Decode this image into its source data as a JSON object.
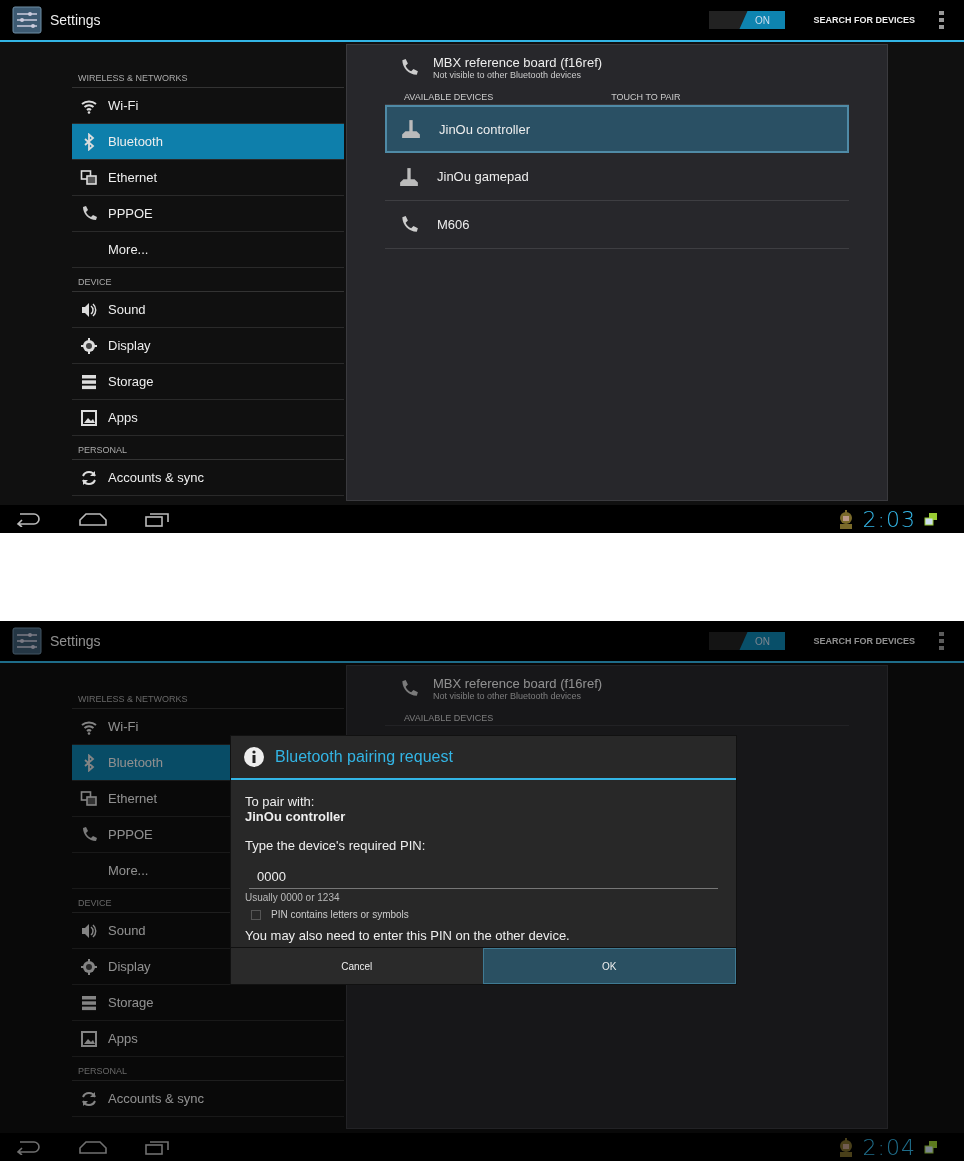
{
  "screens": [
    {
      "action_bar": {
        "title": "Settings",
        "toggle": {
          "label": "ON",
          "on": true
        },
        "action": "SEARCH FOR DEVICES"
      },
      "sidebar": {
        "sections": [
          {
            "header": "WIRELESS & NETWORKS",
            "items": [
              {
                "label": "Wi-Fi",
                "kind": "wifi",
                "selected": false
              },
              {
                "label": "Bluetooth",
                "kind": "bluetooth",
                "selected": true
              },
              {
                "label": "Ethernet",
                "kind": "ethernet",
                "selected": false
              },
              {
                "label": "PPPOE",
                "kind": "phone",
                "selected": false
              },
              {
                "label": "More...",
                "kind": "plain",
                "selected": false
              }
            ]
          },
          {
            "header": "DEVICE",
            "items": [
              {
                "label": "Sound",
                "kind": "sound",
                "selected": false
              },
              {
                "label": "Display",
                "kind": "display",
                "selected": false
              },
              {
                "label": "Storage",
                "kind": "storage",
                "selected": false
              },
              {
                "label": "Apps",
                "kind": "apps",
                "selected": false
              }
            ]
          },
          {
            "header": "PERSONAL",
            "items": [
              {
                "label": "Accounts & sync",
                "kind": "sync",
                "selected": false
              }
            ]
          }
        ]
      },
      "panel": {
        "own_device": {
          "name": "MBX reference board (f16ref)",
          "status": "Not visible to other Bluetooth devices"
        },
        "list_header": "AVAILABLE DEVICES",
        "list_hint": "TOUCH TO PAIR",
        "devices": [
          {
            "name": "JinOu controller",
            "kind": "joystick",
            "selected": true
          },
          {
            "name": "JinOu gamepad",
            "kind": "joystick",
            "selected": false
          },
          {
            "name": "M606",
            "kind": "phone",
            "selected": false
          }
        ]
      },
      "status_bar": {
        "time": "2:03"
      },
      "dimmed": false
    },
    {
      "action_bar": {
        "title": "Settings",
        "toggle": {
          "label": "ON",
          "on": true
        },
        "action": "SEARCH FOR DEVICES"
      },
      "sidebar": {
        "sections": [
          {
            "header": "WIRELESS & NETWORKS",
            "items": [
              {
                "label": "Wi-Fi",
                "kind": "wifi",
                "selected": false
              },
              {
                "label": "Bluetooth",
                "kind": "bluetooth",
                "selected": true
              },
              {
                "label": "Ethernet",
                "kind": "ethernet",
                "selected": false
              },
              {
                "label": "PPPOE",
                "kind": "phone",
                "selected": false
              },
              {
                "label": "More...",
                "kind": "plain",
                "selected": false
              }
            ]
          },
          {
            "header": "DEVICE",
            "items": [
              {
                "label": "Sound",
                "kind": "sound",
                "selected": false
              },
              {
                "label": "Display",
                "kind": "display",
                "selected": false
              },
              {
                "label": "Storage",
                "kind": "storage",
                "selected": false
              },
              {
                "label": "Apps",
                "kind": "apps",
                "selected": false
              }
            ]
          },
          {
            "header": "PERSONAL",
            "items": [
              {
                "label": "Accounts & sync",
                "kind": "sync",
                "selected": false
              }
            ]
          }
        ]
      },
      "panel": {
        "own_device": {
          "name": "MBX reference board (f16ref)",
          "status": "Not visible to other Bluetooth devices"
        },
        "list_header": "AVAILABLE DEVICES"
      },
      "status_bar": {
        "time": "2:04"
      },
      "dimmed": true,
      "dialog": {
        "title": "Bluetooth pairing request",
        "intro": "To pair with:",
        "device": "JinOu controller",
        "prompt": "Type the device's required PIN:",
        "pin": "0000",
        "hint": "Usually 0000 or 1234",
        "checkbox": {
          "label": "PIN contains letters or symbols",
          "checked": false
        },
        "note": "You may also need to enter this PIN on the other device.",
        "buttons": [
          {
            "label": "Cancel",
            "selected": false
          },
          {
            "label": "OK",
            "selected": true
          }
        ]
      }
    }
  ]
}
